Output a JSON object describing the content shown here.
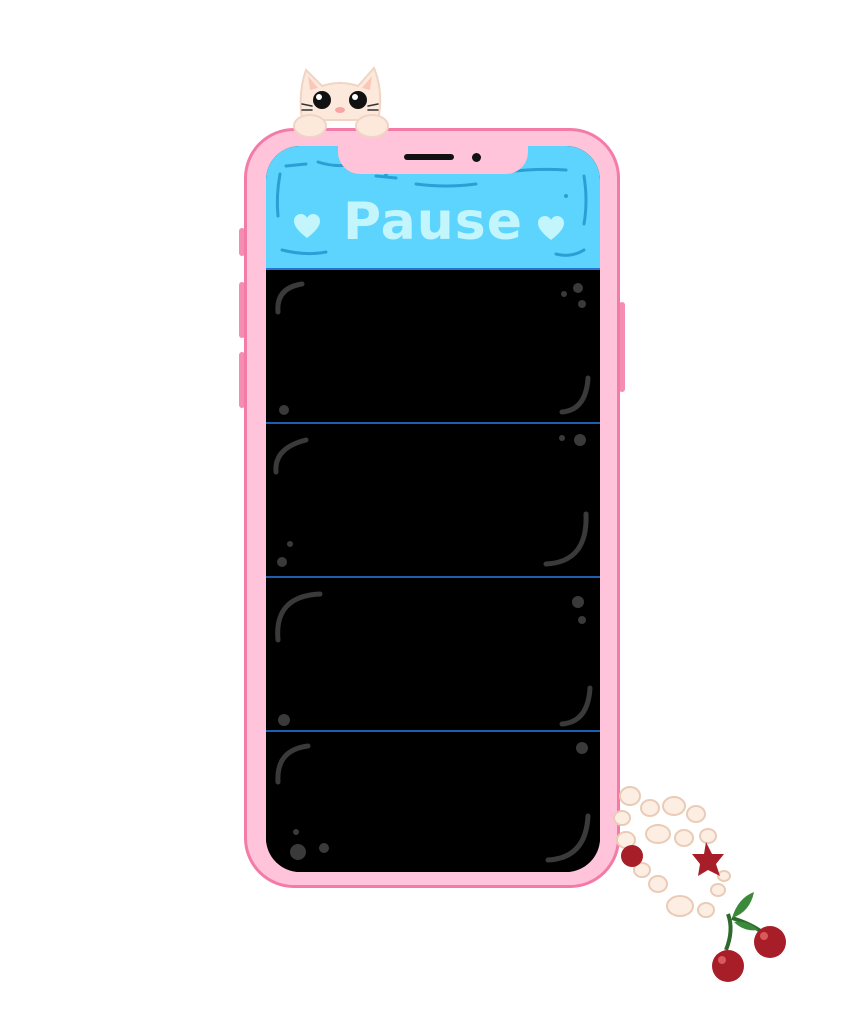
{
  "screen": {
    "title": "Pause"
  },
  "slots": [
    {
      "name": "slot-1"
    },
    {
      "name": "slot-2"
    },
    {
      "name": "slot-3"
    },
    {
      "name": "slot-4"
    }
  ],
  "colors": {
    "phone_fill": "#ffc4d9",
    "phone_border": "#f47ba7",
    "header_fill": "#5cd4fd",
    "title_text": "#c3f5fd",
    "slot_fill": "#000000",
    "divider": "#1f5fb0"
  },
  "icons": {
    "left": "heart-icon",
    "right": "heart-icon",
    "top_decoration": "cat-icon",
    "bottom_decoration": "cherry-icon"
  }
}
